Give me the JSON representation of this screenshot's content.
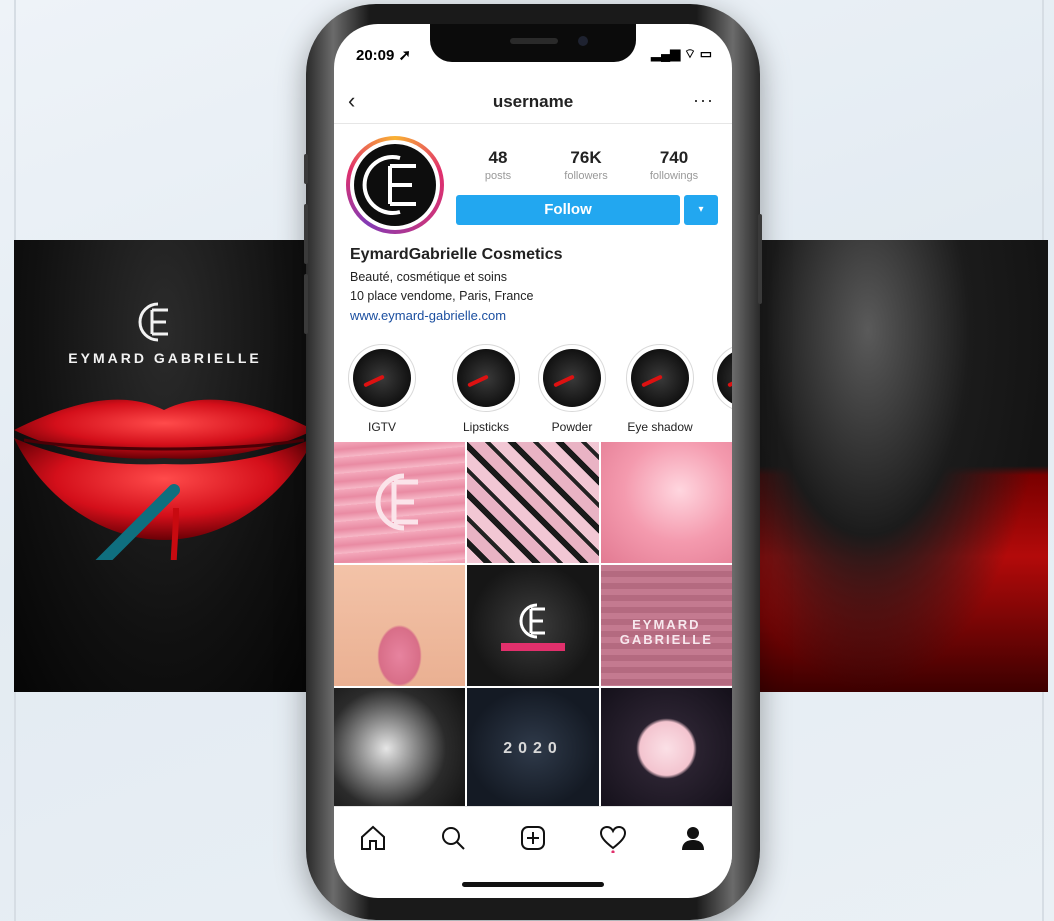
{
  "status_bar": {
    "time": "20:09 ➚",
    "icons": "▂▄▆ ⌔ ▭"
  },
  "header": {
    "back_icon": "chevron-left-icon",
    "title": "username",
    "more_icon": "more-horizontal-icon"
  },
  "profile": {
    "stats": [
      {
        "value": "48",
        "label": "posts"
      },
      {
        "value": "76K",
        "label": "followers"
      },
      {
        "value": "740",
        "label": "followings"
      }
    ],
    "follow_label": "Follow",
    "dropdown_icon": "▾",
    "name": "EymardGabrielle Cosmetics",
    "bio_line1": "Beauté, cosmétique et soins",
    "bio_line2": "10 place vendome, Paris, France",
    "link": "www.eymard-gabrielle.com"
  },
  "highlights": [
    {
      "label": "IGTV"
    },
    {
      "label": "Lipsticks"
    },
    {
      "label": "Powder"
    },
    {
      "label": "Eye shadow"
    },
    {
      "label": ""
    }
  ],
  "banner": {
    "brand_name": "EYMARD GABRIELLE"
  },
  "grid_text": {
    "tile6": "EYMARD  GABRIELLE",
    "tile8": "2020"
  },
  "tab_bar": [
    "home-icon",
    "search-icon",
    "add-post-icon",
    "heart-icon",
    "profile-icon"
  ],
  "colors": {
    "follow_blue": "#22a7f0",
    "link_blue": "#1b4fa0",
    "brand_red": "#d40f1a",
    "brand_pink": "#e9a0b4",
    "notification_dot": "#e1306c"
  }
}
